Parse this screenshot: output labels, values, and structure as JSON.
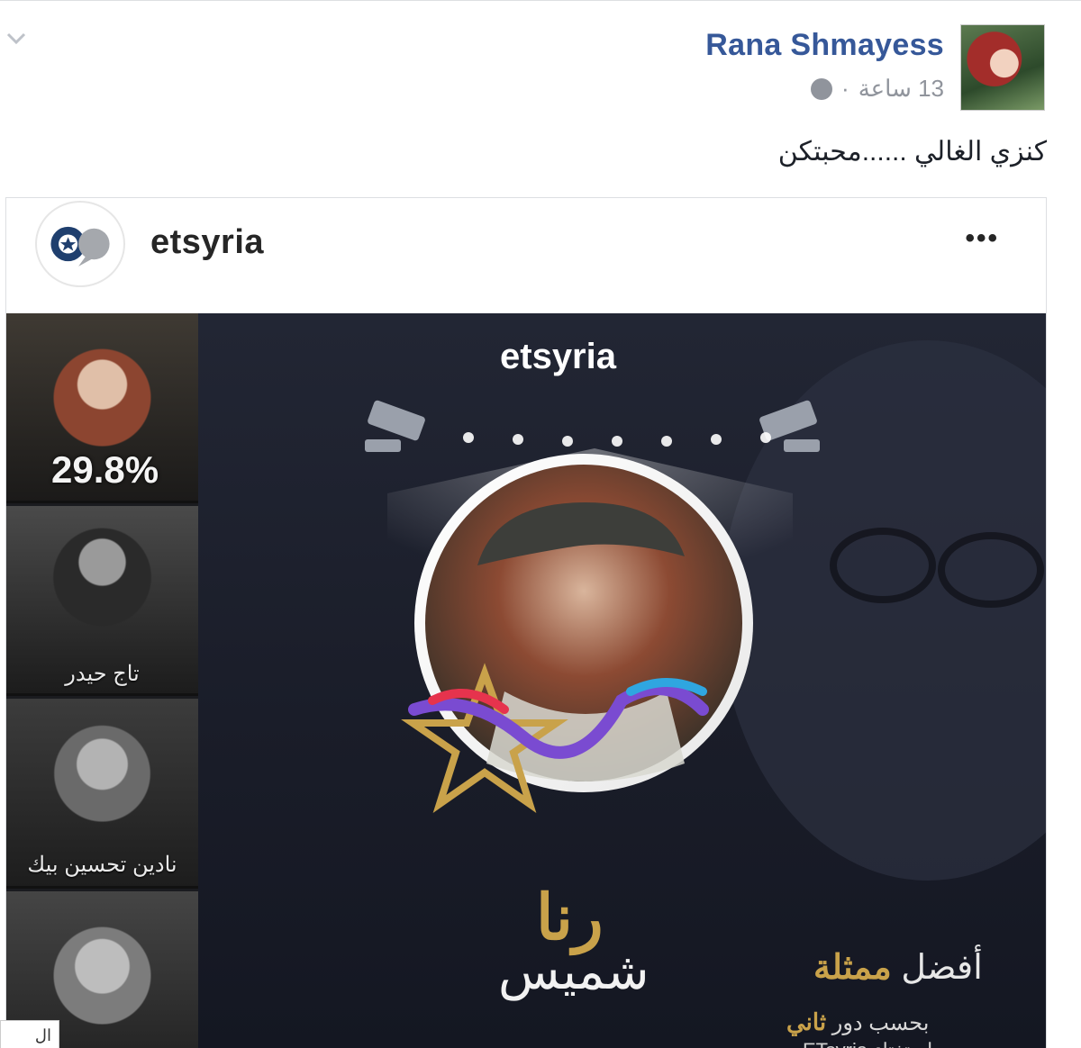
{
  "post": {
    "author_name": "Rana Shmayess",
    "timestamp": "13 ساعة",
    "privacy_icon": "globe-icon",
    "text": "كنزي الغالي ......محبتكن"
  },
  "shared_post": {
    "account_name": "etsyria",
    "more_label": "•••"
  },
  "poster": {
    "brand": "etsyria",
    "sidebar": [
      {
        "percent": "29.8%",
        "label": ""
      },
      {
        "percent": "",
        "label": "تاج حيدر"
      },
      {
        "percent": "",
        "label": "نادين تحسين بيك"
      },
      {
        "percent": "",
        "label": ""
      }
    ],
    "name_first": "رنا",
    "name_last": "شميس",
    "award_prefix": "أفضل",
    "award_title": "ممثلة",
    "award_by": "بحسب",
    "award_role": "دور",
    "award_role_value": "ثاني",
    "award_source": "استفتاء ETsyria"
  },
  "footer": {
    "partial_tag": "ال"
  },
  "colors": {
    "link_blue": "#365899",
    "gold": "#c9a24a",
    "meta_gray": "#90949c",
    "poster_bg": "#1a1d29"
  }
}
